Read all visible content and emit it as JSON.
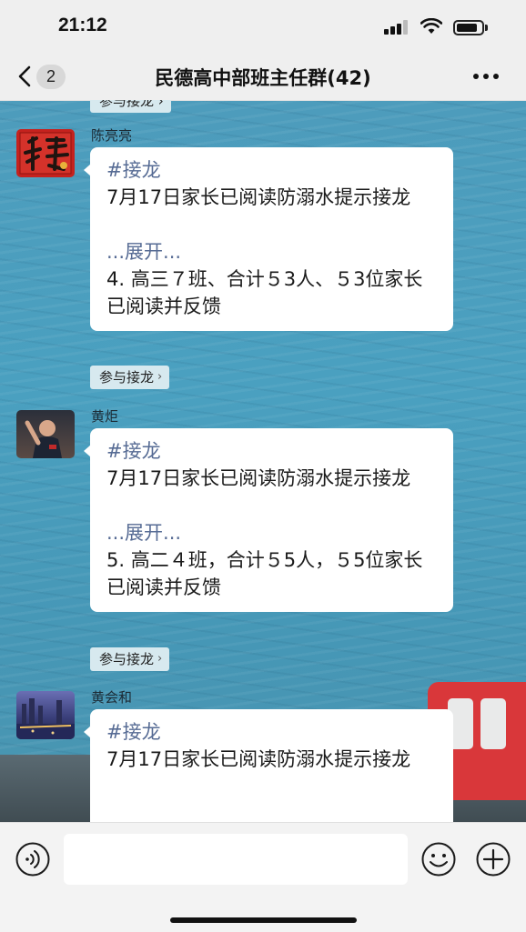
{
  "status_bar": {
    "time": "21:12"
  },
  "nav": {
    "back_count": "2",
    "title": "民德高中部班主任群(42)"
  },
  "top_partial_chip": "参与接龙 ›",
  "messages": [
    {
      "sender": "陈亮亮",
      "tag": "#接龙",
      "text": "7月17日家长已阅读防溺水提示接龙",
      "expand": "...展开...",
      "entry": "4. 高三７班、合计５3人、５3位家长已阅读并反馈",
      "chip": "参与接龙",
      "chip_chevron": "›"
    },
    {
      "sender": "黄炬",
      "tag": "#接龙",
      "text": "7月17日家长已阅读防溺水提示接龙",
      "expand": "...展开...",
      "entry": "5. 高二４班，合计５5人，５5位家长已阅读并反馈",
      "chip": "参与接龙",
      "chip_chevron": "›"
    },
    {
      "sender": "黄会和",
      "tag": "#接龙",
      "text": "7月17日家长已阅读防溺水提示接龙"
    }
  ],
  "input": {
    "placeholder": ""
  },
  "colors": {
    "link": "#566b94",
    "bubble": "#ffffff",
    "chip_bg": "#d7e9ef",
    "bus": "#d9373a"
  },
  "icons": [
    "chevron-left-icon",
    "more-dots-icon",
    "voice-icon",
    "emoji-icon",
    "plus-icon",
    "signal-icon",
    "wifi-icon",
    "battery-icon"
  ]
}
